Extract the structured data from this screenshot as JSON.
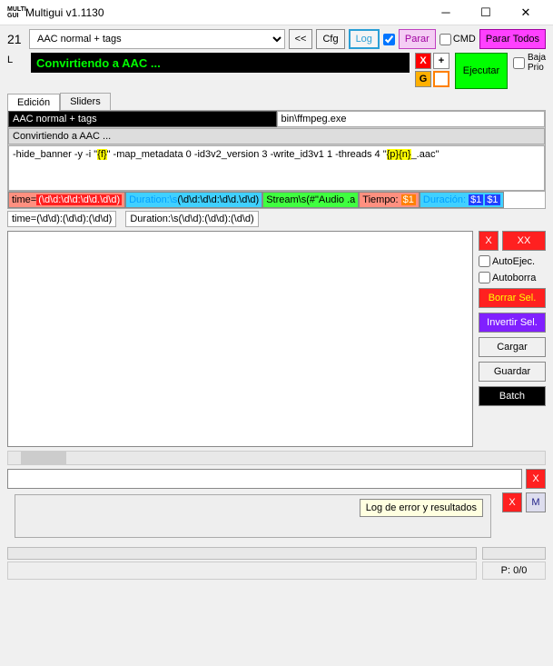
{
  "window": {
    "icon_t": "MULTI",
    "icon_b": "GUI",
    "title": "Multigui v1.1130"
  },
  "toolbar": {
    "number": "21",
    "combo": "AAC normal + tags",
    "prev": "<<",
    "cfg": "Cfg",
    "log": "Log",
    "parar": "Parar",
    "cmd": "CMD",
    "parar_todos": "Parar Todos",
    "letter": "L"
  },
  "status": "Convirtiendo a AAC ...",
  "exec": {
    "label": "Ejecutar",
    "baja": "Baja",
    "prio": "Prio",
    "g": "G",
    "plus": "+",
    "x": "X"
  },
  "tabs": {
    "edicion": "Edición",
    "sliders": "Sliders"
  },
  "fields": {
    "preset": "AAC normal + tags",
    "exe": "bin\\ffmpeg.exe",
    "desc": "Convirtiendo a AAC ...",
    "cmd_pre": "-hide_banner -y -i \"",
    "cmd_f": "{f}",
    "cmd_mid": "\" -map_metadata 0 -id3v2_version 3 -write_id3v1 1 -threads 4 \"",
    "cmd_pn": "{p}{n}",
    "cmd_post": "_.aac\""
  },
  "regex1": {
    "time_lbl": "time=",
    "time_pat": "(\\d\\d:\\d\\d:\\d\\d.\\d\\d)",
    "dur_lbl": "Duration:\\s",
    "dur_pat": "(\\d\\d:\\d\\d:\\d\\d.\\d\\d)",
    "stream_lbl": "Stream\\s",
    "stream_pat": "(#\"Audio .a",
    "tiempo": "Tiempo: ",
    "t1": "$1",
    "duracion": "Duración: ",
    "d1": "$1",
    "d2": "$1"
  },
  "regex2": {
    "a": "time=(\\d\\d):(\\d\\d):(\\d\\d)",
    "b": "Duration:\\s(\\d\\d):(\\d\\d):(\\d\\d)"
  },
  "side": {
    "x": "X",
    "xx": "XX",
    "autoejec": "AutoEjec.",
    "autoborra": "Autoborra",
    "borrar": "Borrar Sel.",
    "invertir": "Invertir Sel.",
    "cargar": "Cargar",
    "guardar": "Guardar",
    "batch": "Batch"
  },
  "log": {
    "tooltip": "Log de error y resultados",
    "x": "X",
    "m": "M"
  },
  "footer": {
    "p": "P: 0/0"
  }
}
